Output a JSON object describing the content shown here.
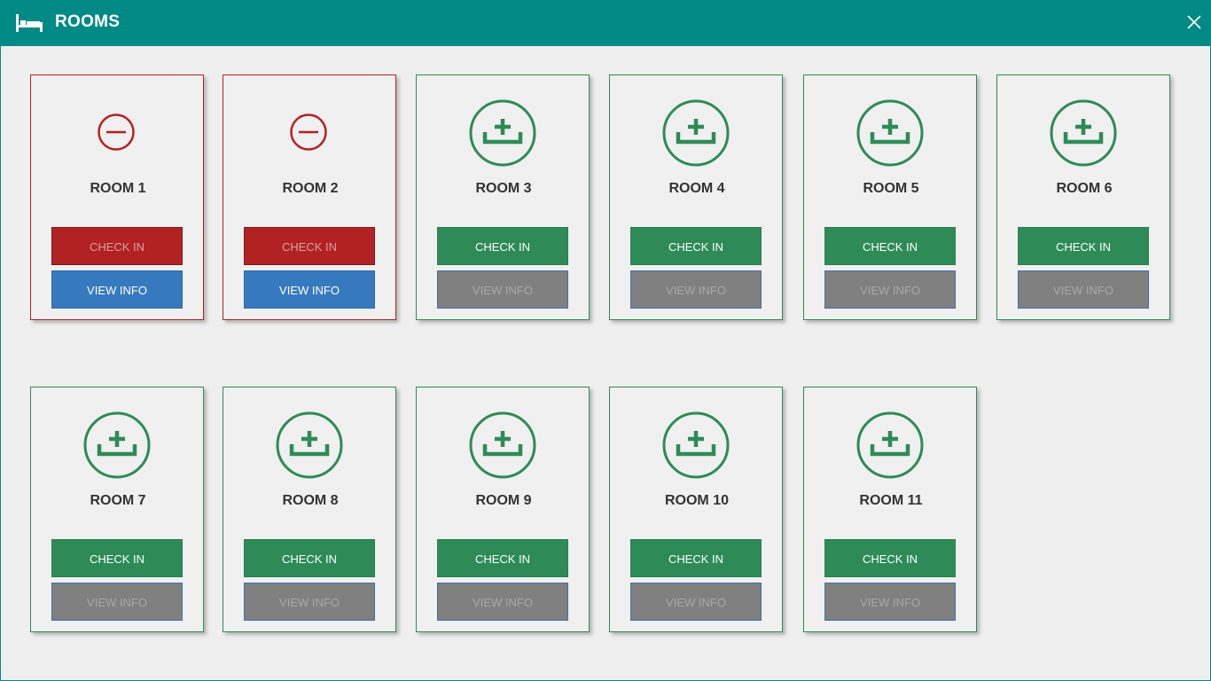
{
  "window": {
    "title": "ROOMS",
    "icon": "bed-icon",
    "close_icon": "close-icon",
    "accent_color": "#008a85"
  },
  "colors": {
    "available": "#2e8b57",
    "occupied": "#b22222",
    "info_enabled": "#3779bd",
    "info_disabled": "#808080"
  },
  "rooms": [
    {
      "name": "ROOM 1",
      "status": "occupied",
      "status_icon": "minus-circle-icon",
      "checkin_label": "CHECK IN",
      "info_label": "VIEW INFO"
    },
    {
      "name": "ROOM 2",
      "status": "occupied",
      "status_icon": "minus-circle-icon",
      "checkin_label": "CHECK IN",
      "info_label": "VIEW INFO"
    },
    {
      "name": "ROOM 3",
      "status": "available",
      "status_icon": "checkin-tray-icon",
      "checkin_label": "CHECK IN",
      "info_label": "VIEW INFO"
    },
    {
      "name": "ROOM 4",
      "status": "available",
      "status_icon": "checkin-tray-icon",
      "checkin_label": "CHECK IN",
      "info_label": "VIEW INFO"
    },
    {
      "name": "ROOM 5",
      "status": "available",
      "status_icon": "checkin-tray-icon",
      "checkin_label": "CHECK IN",
      "info_label": "VIEW INFO"
    },
    {
      "name": "ROOM 6",
      "status": "available",
      "status_icon": "checkin-tray-icon",
      "checkin_label": "CHECK IN",
      "info_label": "VIEW INFO"
    },
    {
      "name": "ROOM 7",
      "status": "available",
      "status_icon": "checkin-tray-icon",
      "checkin_label": "CHECK IN",
      "info_label": "VIEW INFO"
    },
    {
      "name": "ROOM 8",
      "status": "available",
      "status_icon": "checkin-tray-icon",
      "checkin_label": "CHECK IN",
      "info_label": "VIEW INFO"
    },
    {
      "name": "ROOM 9",
      "status": "available",
      "status_icon": "checkin-tray-icon",
      "checkin_label": "CHECK IN",
      "info_label": "VIEW INFO"
    },
    {
      "name": "ROOM 10",
      "status": "available",
      "status_icon": "checkin-tray-icon",
      "checkin_label": "CHECK IN",
      "info_label": "VIEW INFO"
    },
    {
      "name": "ROOM 11",
      "status": "available",
      "status_icon": "checkin-tray-icon",
      "checkin_label": "CHECK IN",
      "info_label": "VIEW INFO"
    }
  ]
}
